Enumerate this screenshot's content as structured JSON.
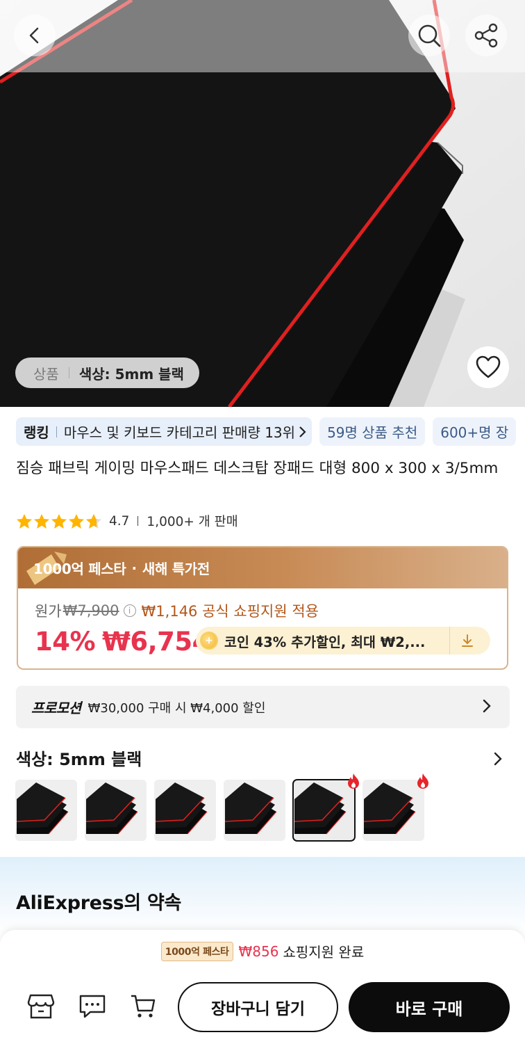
{
  "hero": {
    "variant_label": "상품",
    "variant_value": "색상: 5mm 블랙",
    "icons": [
      "back-icon",
      "search-icon",
      "share-icon",
      "heart-icon"
    ]
  },
  "chips": {
    "rank_label": "랭킹",
    "rank_text": "마우스 및 키보드 카테고리 판매량 13위",
    "recommend": "59명 상품 추천",
    "more": "600+명 장"
  },
  "product": {
    "title": "짐승 패브릭 게이밍 마우스패드 데스크탑 장패드 대형 800 x 300 x 3/5mm",
    "rating": "4.7",
    "stars": 4.7,
    "sold": "1,000+ 개 판매"
  },
  "price_card": {
    "banner_brand": "1000억 페스타",
    "banner_dot": "·",
    "banner_event": "새해 특가전",
    "original_label": "원가",
    "original_price": "₩7,900",
    "subsidy": "₩1,146 공식 쇼핑지원 적용",
    "discount": "14%",
    "price": "₩6,754",
    "coin_text": "코인 43% 추가할인, 최대 ₩2,...",
    "colors": {
      "accent": "#e8334e",
      "banner": "#b06e36",
      "coin_bg": "#fdf1d3"
    }
  },
  "promotion": {
    "label": "프로모션",
    "text": "₩30,000 구매 시 ₩4,000 할인"
  },
  "color_selector": {
    "title": "색상: 5mm 블랙",
    "swatch_count": 6,
    "selected_index": 4,
    "hot_indices": [
      4,
      5
    ]
  },
  "promise": {
    "title": "AliExpress의 약속"
  },
  "bottom_bar": {
    "fest_badge": "1000억 페스타",
    "fest_amount": "₩856",
    "fest_text": "쇼핑지원 완료",
    "add_to_cart": "장바구니 담기",
    "buy_now": "바로 구매",
    "icons": [
      "store-icon",
      "chat-icon",
      "cart-icon"
    ]
  }
}
